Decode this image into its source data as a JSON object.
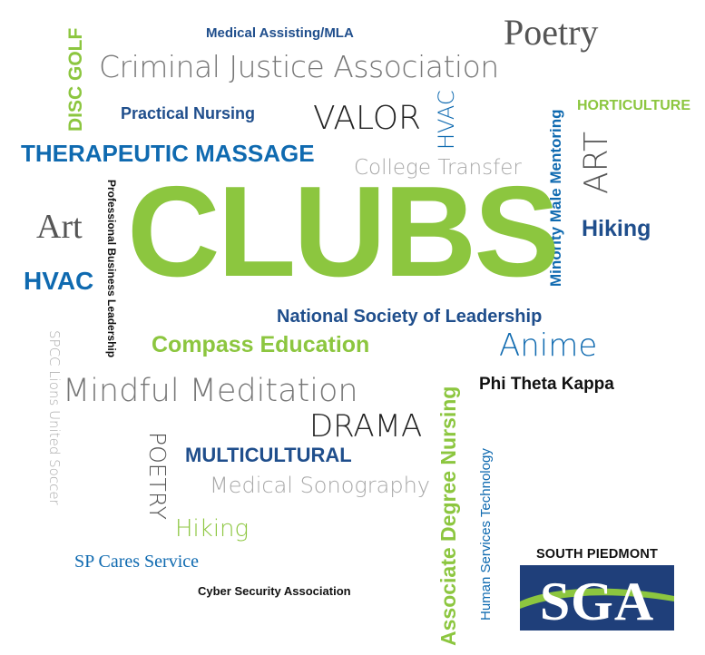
{
  "words": {
    "medical_assisting": "Medical Assisting/MLA",
    "poetry_serif": "Poetry",
    "disc_golf": "DISC GOLF",
    "criminal_justice": "Criminal Justice Association",
    "minority_male": "Minority Male Mentoring",
    "horticulture": "HORTICULTURE",
    "practical_nursing": "Practical Nursing",
    "valor": "VALOR",
    "hvac_vertical": "HVAC",
    "therapeutic_massage": "THERAPEUTIC MASSAGE",
    "art_vertical": "ART",
    "college_transfer": "College Transfer",
    "professional_business": "Professional Business Leadership",
    "clubs": "CLUBS",
    "art_serif": "Art",
    "hiking_blue": "Hiking",
    "hvac": "HVAC",
    "national_society": "National Society of Leadership",
    "spcc_lions": "SPCC Lions United Soccer",
    "compass_education": "Compass Education",
    "anime": "Anime",
    "associate_degree": "Associate Degree Nursing",
    "phi_theta_kappa": "Phi Theta Kappa",
    "mindful_meditation": "Mindful Meditation",
    "human_services": "Human Services Technology",
    "drama": "DRAMA",
    "poetry_vertical": "POETRY",
    "multicultural": "MULTICULTURAL",
    "medical_sonography": "Medical Sonography",
    "hiking_green": "Hiking",
    "sp_cares": "SP Cares Service",
    "cyber_security": "Cyber Security Association"
  },
  "logo": {
    "top_text": "SOUTH PIEDMONT",
    "letters": "SGA"
  },
  "colors": {
    "green": "#8cc63f",
    "blue": "#0f6ab0",
    "navy": "#1f4e8c",
    "gray": "#8a8a8a",
    "light_gray": "#a7a7a7",
    "dark": "#222222",
    "black": "#111111",
    "logo_navy": "#1f3f7a"
  }
}
